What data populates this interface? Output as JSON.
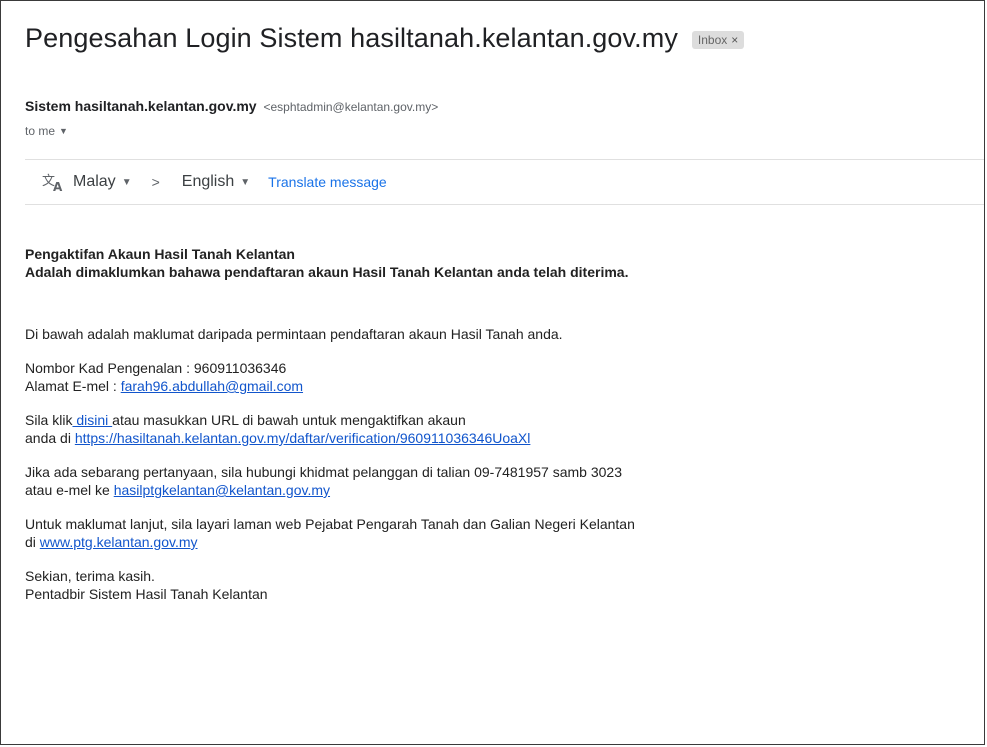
{
  "email": {
    "subject": "Pengesahan Login Sistem hasiltanah.kelantan.gov.my",
    "label_chip": "Inbox",
    "label_chip_close": "×",
    "sender_name": "Sistem hasiltanah.kelantan.gov.my",
    "sender_email": "<esphtadmin@kelantan.gov.my>",
    "to_line": "to me"
  },
  "translate": {
    "icon": "translate-icon",
    "from_lang": "Malay",
    "arrow": ">",
    "to_lang": "English",
    "link": "Translate message"
  },
  "body": {
    "heading1": "Pengaktifan Akaun Hasil Tanah Kelantan",
    "heading2": "Adalah dimaklumkan bahawa pendaftaran akaun Hasil Tanah Kelantan anda telah diterima.",
    "intro": "Di bawah adalah maklumat daripada permintaan pendaftaran akaun Hasil Tanah anda.",
    "ic_line": "Nombor Kad Pengenalan : 960911036346",
    "email_label": "Alamat E-mel : ",
    "email_link": "farah96.abdullah@gmail.com",
    "click_prefix": "Sila klik",
    "click_link": " disini ",
    "click_suffix": "atau masukkan URL di bawah untuk mengaktifkan akaun",
    "url_prefix": "anda di ",
    "url_link": "https://hasiltanah.kelantan.gov.my/daftar/verification/960911036346UoaXl",
    "question_line": "Jika ada sebarang pertanyaan, sila hubungi khidmat pelanggan di talian 09-7481957 samb 3023",
    "question_prefix": "atau e-mel ke ",
    "question_link": "hasilptgkelantan@kelantan.gov.my",
    "info_line": "Untuk maklumat lanjut, sila layari laman web Pejabat Pengarah Tanah dan Galian Negeri Kelantan",
    "info_prefix": "di ",
    "info_link": "www.ptg.kelantan.gov.my",
    "closing1": "Sekian, terima kasih.",
    "closing2": "Pentadbir Sistem Hasil Tanah Kelantan"
  },
  "colors": {
    "link": "#1155cc",
    "translate_link": "#1a73e8",
    "chip_bg": "#dddddd"
  }
}
